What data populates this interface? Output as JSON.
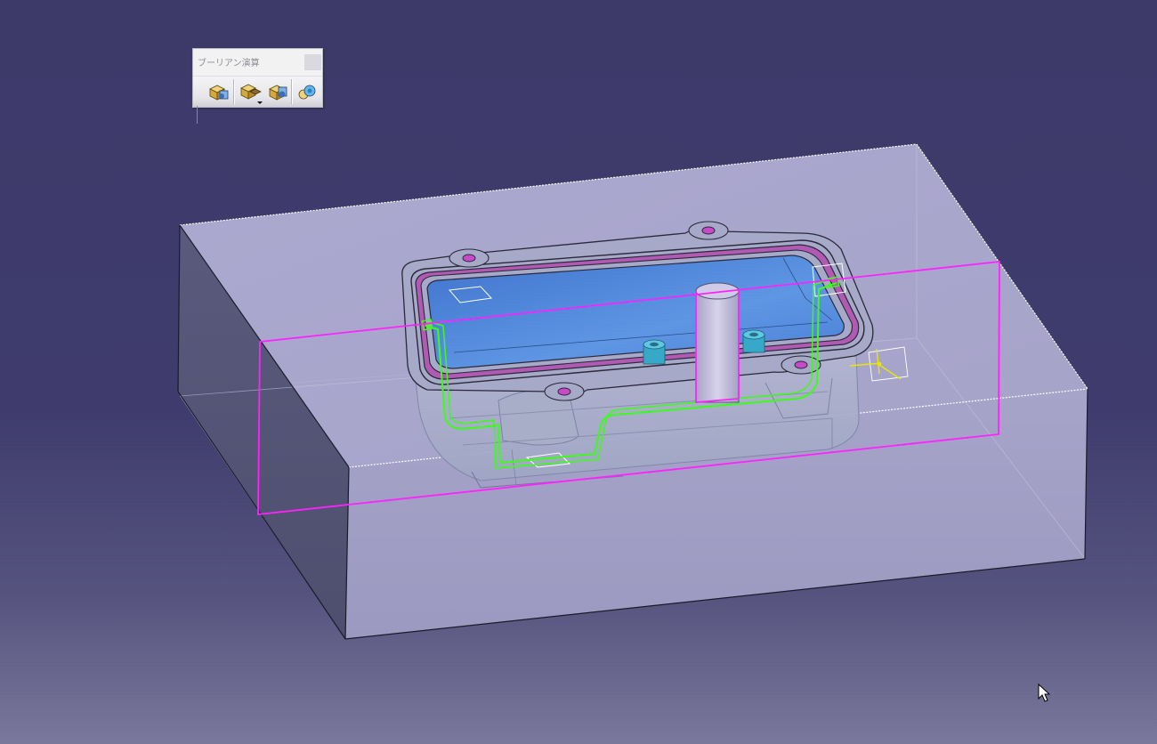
{
  "toolbar": {
    "title": "ブーリアン演算",
    "buttons": [
      {
        "name": "assemble-button",
        "icon": "boolean-assemble-icon"
      },
      {
        "name": "add-button",
        "icon": "boolean-add-icon",
        "has_dropdown": true
      },
      {
        "name": "remove-button",
        "icon": "boolean-remove-icon"
      },
      {
        "name": "union-trim-button",
        "icon": "boolean-union-trim-icon"
      }
    ]
  },
  "colors": {
    "background_top": "#3d3a6a",
    "background_bottom": "#7a789b",
    "block_face": "#a9a6cc",
    "plane_outline": "#ff22ff",
    "curve_highlight": "#39ff14",
    "pocket_blue": "#4c82d8",
    "insert_cyan": "#37a8c8",
    "axis_yellow": "#e6e600"
  }
}
